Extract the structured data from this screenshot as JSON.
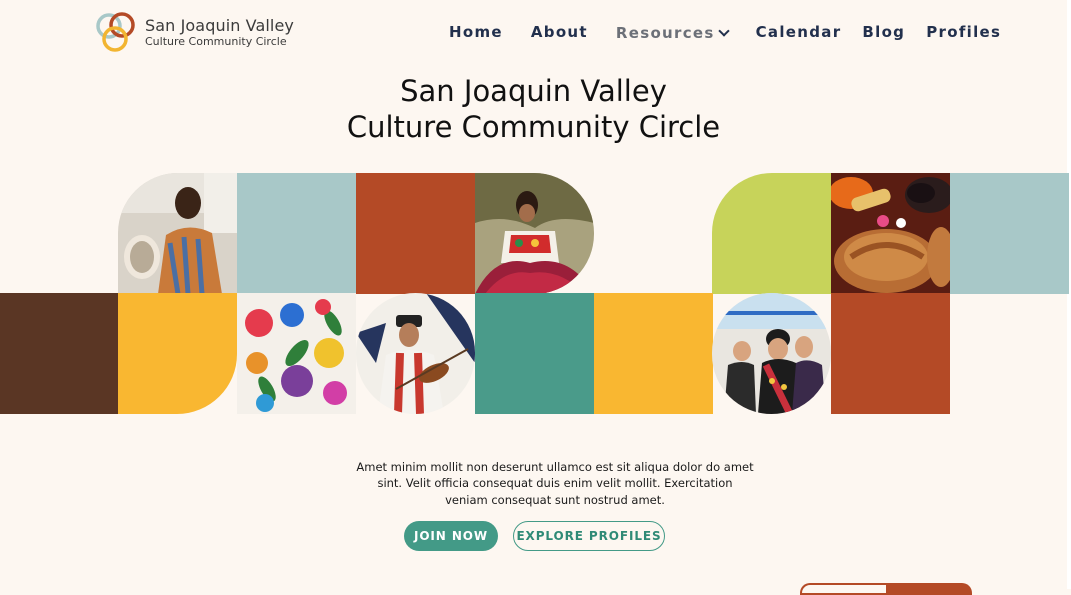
{
  "brand": {
    "name_line1": "San Joaquin Valley",
    "name_line2": "Culture Community Circle",
    "logo_colors": [
      "#a8c8c8",
      "#b44a26",
      "#f2b531"
    ]
  },
  "nav": {
    "items": [
      {
        "label": "Home"
      },
      {
        "label": "About"
      },
      {
        "label": "Resources",
        "has_dropdown": true
      },
      {
        "label": "Calendar"
      },
      {
        "label": "Blog"
      },
      {
        "label": "Profiles"
      }
    ]
  },
  "hero": {
    "title_line1": "San Joaquin Valley",
    "title_line2": "Culture Community Circle",
    "intro": "Amet minim mollit non deserunt ullamco est sit aliqua dolor do amet sint. Velit officia consequat duis enim velit mollit. Exercitation veniam consequat sunt nostrud amet."
  },
  "buttons": {
    "join": "JOIN NOW",
    "explore": "EXPLORE PROFILES"
  },
  "colors": {
    "background": "#fdf7f1",
    "teal": "#439a87",
    "light_teal": "#a8c8c8",
    "rust": "#b44a26",
    "yellow": "#f9b731",
    "lime": "#c7d35a",
    "brown": "#5a3624",
    "nav_text": "#22304d"
  }
}
